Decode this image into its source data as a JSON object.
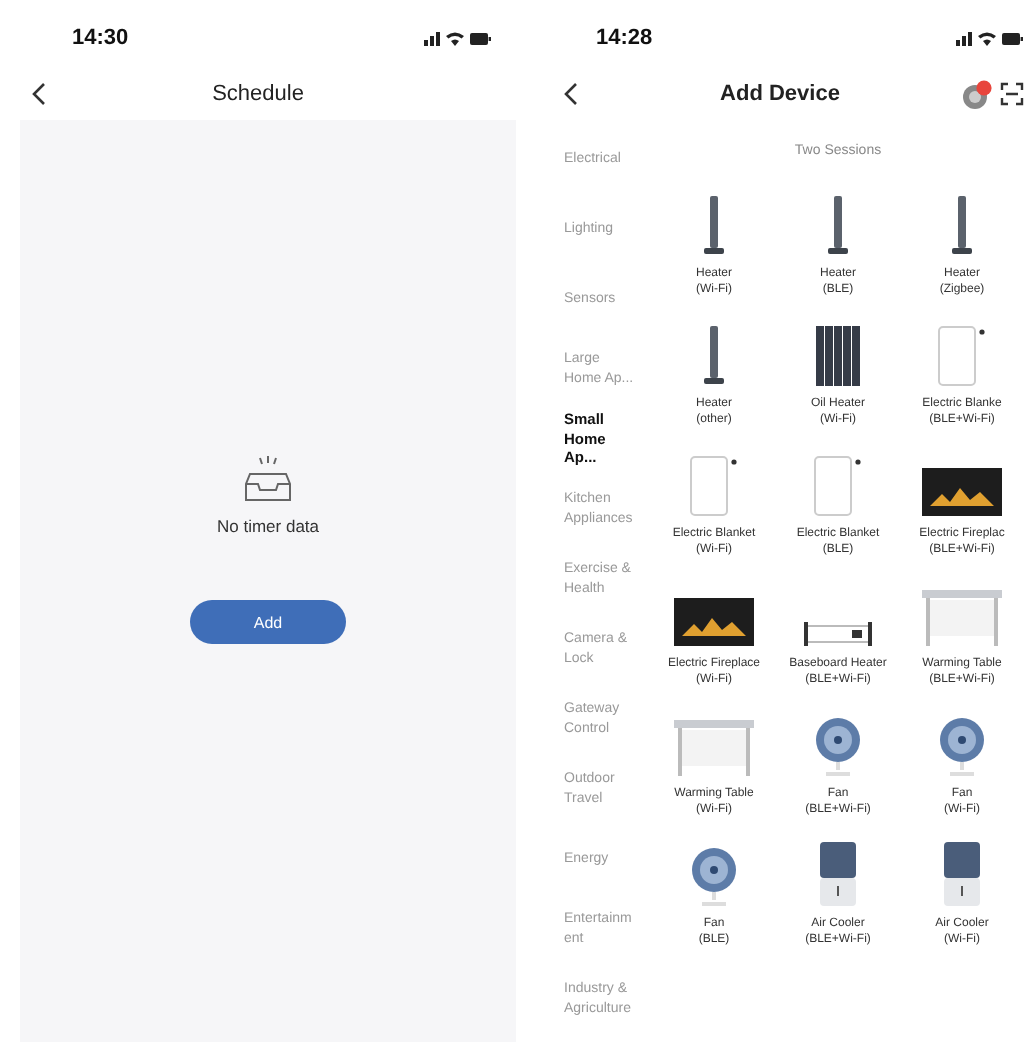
{
  "schedule_screen": {
    "status_bar": {
      "time": "14:30"
    },
    "title": "Schedule",
    "empty_message": "No timer data",
    "add_button": "Add"
  },
  "add_device_screen": {
    "status_bar": {
      "time": "14:28"
    },
    "title": "Add Device",
    "categories": [
      {
        "label": "Electrical",
        "selected": false
      },
      {
        "label": "Lighting",
        "selected": false
      },
      {
        "label": "Sensors",
        "selected": false
      },
      {
        "label": "Large Home Ap...",
        "selected": false
      },
      {
        "label": "Small Home Ap...",
        "selected": true
      },
      {
        "label": "Kitchen Appliances",
        "selected": false
      },
      {
        "label": "Exercise & Health",
        "selected": false
      },
      {
        "label": "Camera & Lock",
        "selected": false
      },
      {
        "label": "Gateway Control",
        "selected": false
      },
      {
        "label": "Outdoor Travel",
        "selected": false
      },
      {
        "label": "Energy",
        "selected": false
      },
      {
        "label": "Entertainm ent",
        "selected": false
      },
      {
        "label": "Industry & Agriculture",
        "selected": false
      }
    ],
    "section_title": "Two Sessions",
    "devices": [
      {
        "kind": "tower",
        "name": "Heater",
        "protocol": "(Wi-Fi)"
      },
      {
        "kind": "tower",
        "name": "Heater",
        "protocol": "(BLE)"
      },
      {
        "kind": "tower",
        "name": "Heater",
        "protocol": "(Zigbee)"
      },
      {
        "kind": "tower",
        "name": "Heater",
        "protocol": "(other)"
      },
      {
        "kind": "oil",
        "name": "Oil Heater",
        "protocol": "(Wi-Fi)"
      },
      {
        "kind": "panel",
        "name": "Electric Blanke",
        "protocol": "(BLE+Wi-Fi)"
      },
      {
        "kind": "panel",
        "name": "Electric Blanket",
        "protocol": "(Wi-Fi)"
      },
      {
        "kind": "panel",
        "name": "Electric Blanket",
        "protocol": "(BLE)"
      },
      {
        "kind": "fireplace",
        "name": "Electric Fireplac",
        "protocol": "(BLE+Wi-Fi)"
      },
      {
        "kind": "fireplace",
        "name": "Electric Fireplace",
        "protocol": "(Wi-Fi)"
      },
      {
        "kind": "baseboard",
        "name": "Baseboard Heater",
        "protocol": "(BLE+Wi-Fi)"
      },
      {
        "kind": "table",
        "name": "Warming Table",
        "protocol": "(BLE+Wi-Fi)"
      },
      {
        "kind": "table",
        "name": "Warming Table",
        "protocol": "(Wi-Fi)"
      },
      {
        "kind": "fan",
        "name": "Fan",
        "protocol": "(BLE+Wi-Fi)"
      },
      {
        "kind": "fan",
        "name": "Fan",
        "protocol": "(Wi-Fi)"
      },
      {
        "kind": "fan",
        "name": "Fan",
        "protocol": "(BLE)"
      },
      {
        "kind": "cooler",
        "name": "Air Cooler",
        "protocol": "(BLE+Wi-Fi)"
      },
      {
        "kind": "cooler",
        "name": "Air Cooler",
        "protocol": "(Wi-Fi)"
      }
    ]
  }
}
